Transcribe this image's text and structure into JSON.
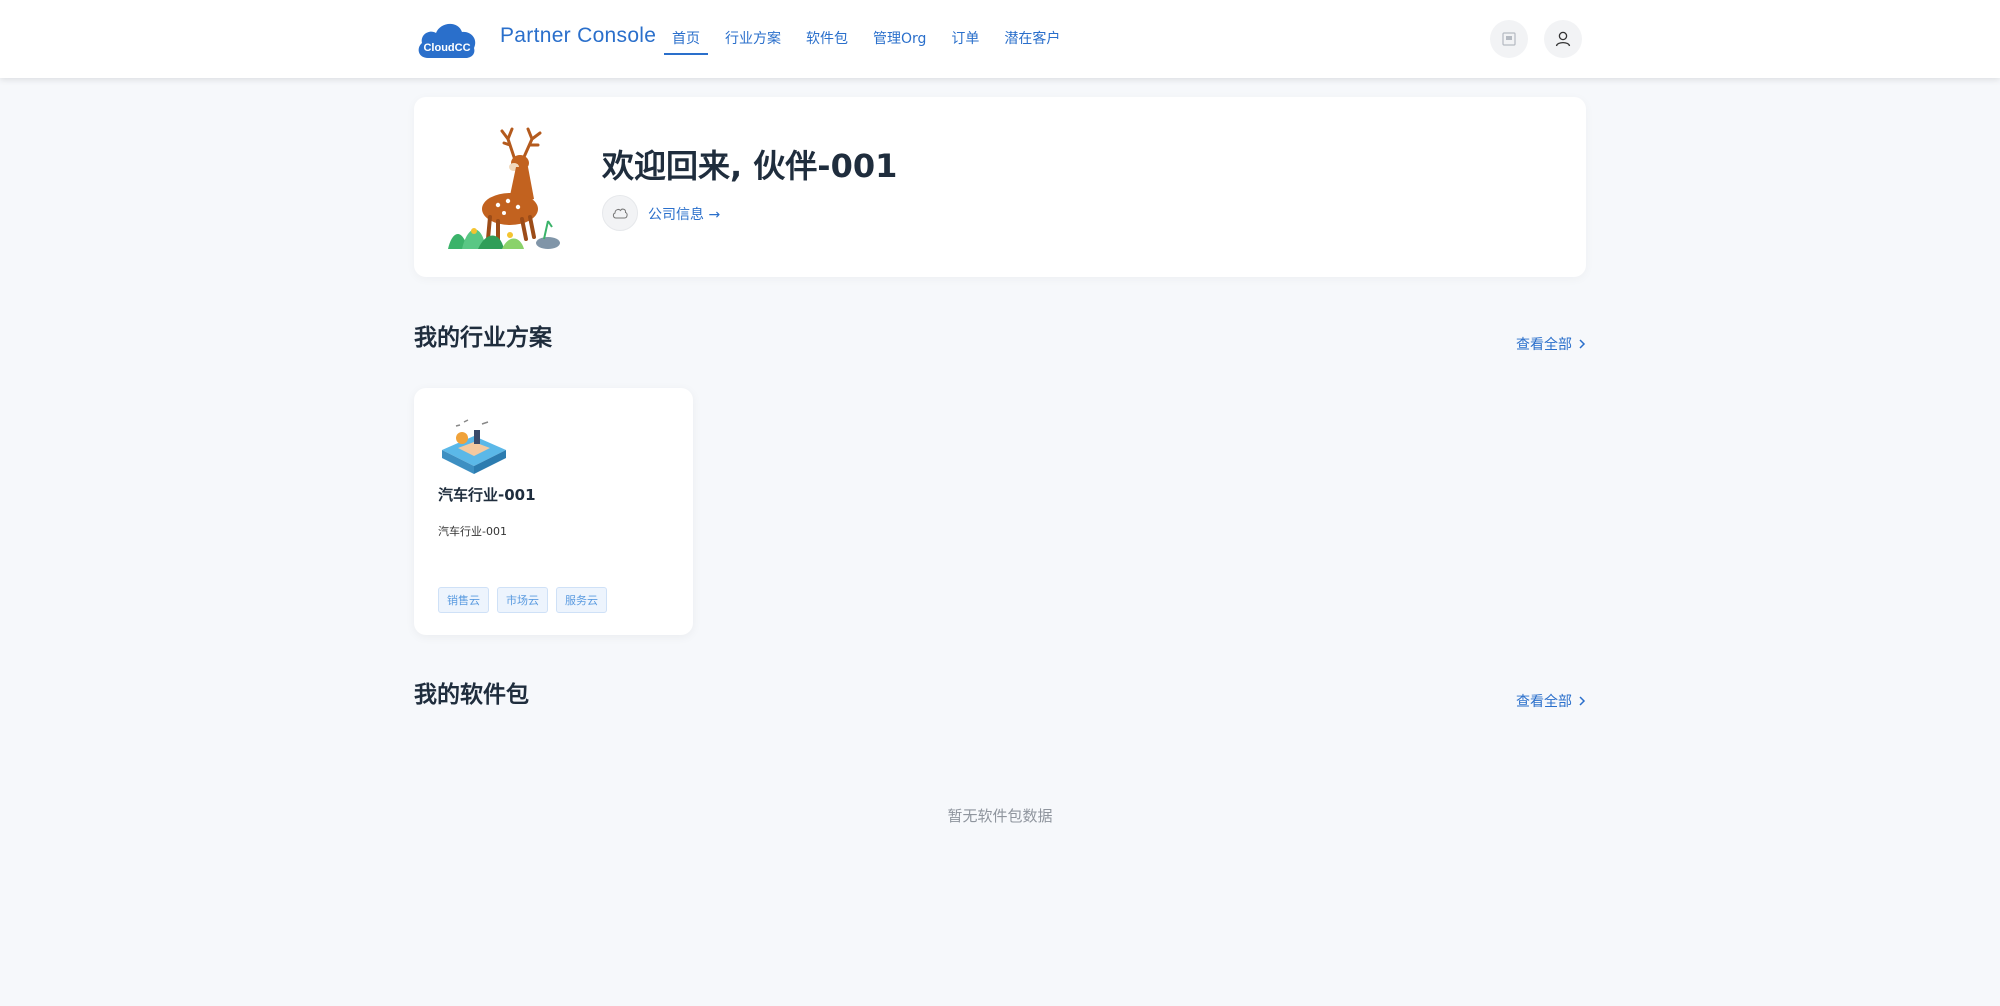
{
  "header": {
    "brand": "Partner Console",
    "logo_text": "CloudCC",
    "nav": [
      {
        "label": "首页",
        "active": true
      },
      {
        "label": "行业方案",
        "active": false
      },
      {
        "label": "软件包",
        "active": false
      },
      {
        "label": "管理Org",
        "active": false
      },
      {
        "label": "订单",
        "active": false
      },
      {
        "label": "潜在客户",
        "active": false
      }
    ],
    "icons": [
      "message-icon",
      "user-icon"
    ]
  },
  "welcome": {
    "title": "欢迎回来, 伙伴-001",
    "company_link": "公司信息 →"
  },
  "solutions": {
    "title": "我的行业方案",
    "view_all": "查看全部",
    "items": [
      {
        "name": "汽车行业-001",
        "description": "汽车行业-001",
        "tags": [
          "销售云",
          "市场云",
          "服务云"
        ]
      }
    ]
  },
  "packages": {
    "title": "我的软件包",
    "view_all": "查看全部",
    "empty_text": "暂无软件包数据"
  },
  "colors": {
    "accent": "#2a6fcb",
    "background": "#f6f8fb",
    "tag_text": "#5b9be0",
    "tag_bg": "#edf4fd"
  }
}
